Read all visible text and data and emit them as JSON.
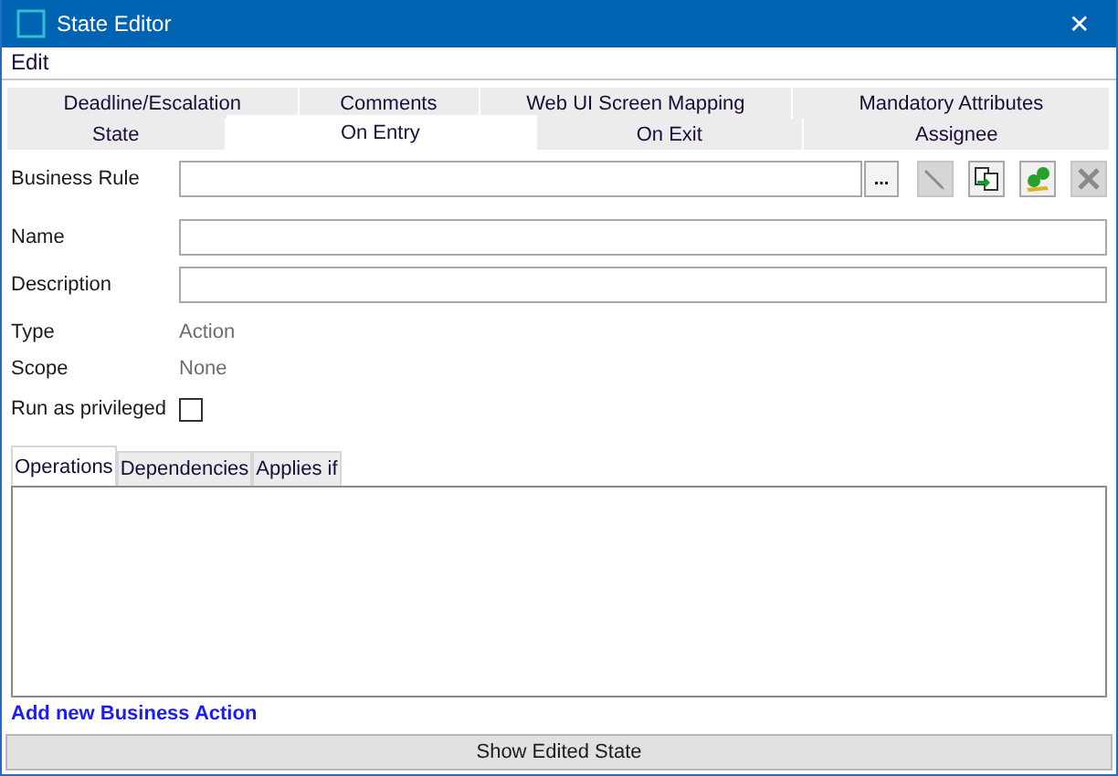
{
  "window": {
    "title": "State Editor",
    "close": "✕"
  },
  "menu": [
    "Edit"
  ],
  "tab_rows": [
    [
      {
        "label": "Deadline/Escalation",
        "selected": false
      },
      {
        "label": "Comments",
        "selected": false
      },
      {
        "label": "Web UI Screen Mapping",
        "selected": false
      },
      {
        "label": "Mandatory Attributes",
        "selected": false
      }
    ],
    [
      {
        "label": "State",
        "selected": false
      },
      {
        "label": "On Entry",
        "selected": true
      },
      {
        "label": "On Exit",
        "selected": false
      },
      {
        "label": "Assignee",
        "selected": false
      }
    ]
  ],
  "business_rule": {
    "label": "Business Rule",
    "browse": "...",
    "tools": [
      {
        "kind": "edit",
        "disabled": true
      },
      {
        "kind": "copy",
        "disabled": false
      },
      {
        "kind": "new",
        "disabled": false
      },
      {
        "kind": "delete",
        "disabled": true
      }
    ]
  },
  "fields": [
    {
      "label": "Name"
    },
    {
      "label": "Description"
    }
  ],
  "info": [
    {
      "label": "Type",
      "value": "Action"
    },
    {
      "label": "Scope",
      "value": "None"
    }
  ],
  "privileged": {
    "label": "Run as privileged",
    "checked": false
  },
  "inner_tabs": [
    {
      "label": "Operations",
      "selected": true
    },
    {
      "label": "Dependencies",
      "selected": false
    },
    {
      "label": "Applies if",
      "selected": false
    }
  ],
  "add_link": "Add new Business Action",
  "show_button": "Show Edited State"
}
